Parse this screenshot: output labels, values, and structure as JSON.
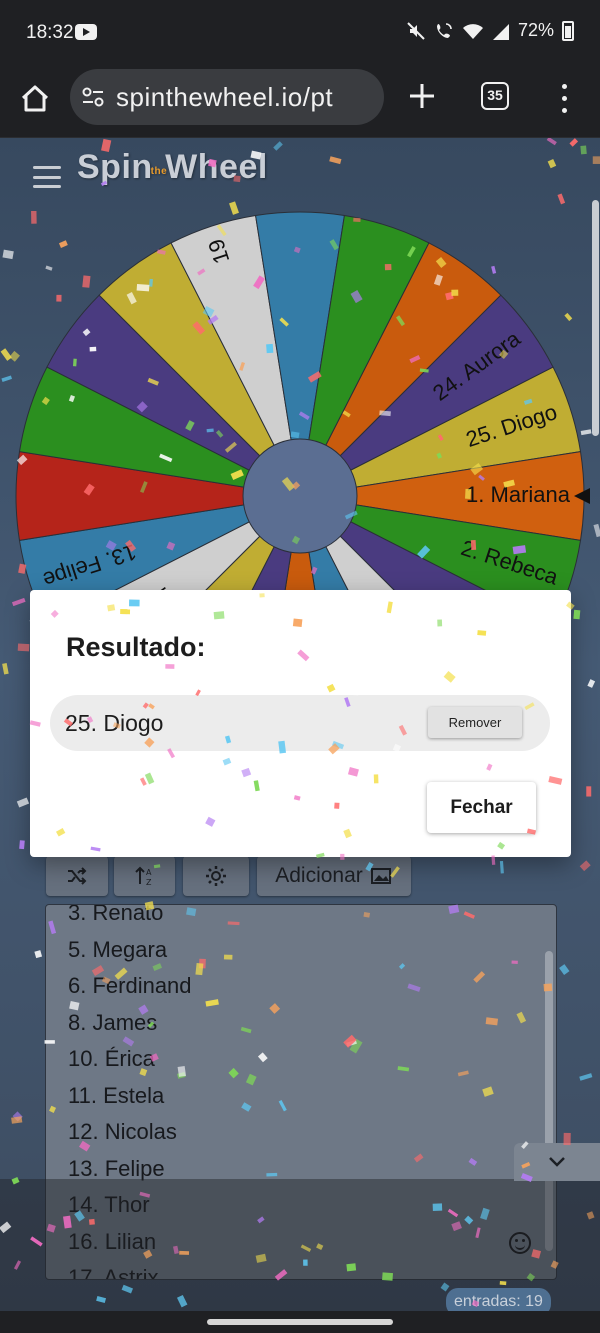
{
  "status_bar": {
    "time": "18:32",
    "battery": "72%",
    "icons": [
      "youtube-icon",
      "mute-icon",
      "wifi-calling-icon",
      "wifi-icon",
      "signal-icon",
      "battery-icon"
    ]
  },
  "browser": {
    "url": "spinthewheel.io/pt",
    "tab_count": "35",
    "icons": [
      "home-icon",
      "site-settings-icon",
      "plus-icon",
      "more-vert-icon"
    ]
  },
  "app": {
    "logo_main_a": "Spin",
    "logo_the": "the",
    "logo_main_b": "Wheel"
  },
  "wheel": {
    "segments": [
      {
        "label": "25. Diogo",
        "color": "#c0ad33"
      },
      {
        "label": "1. Mariana",
        "color": "#d0600f"
      },
      {
        "label": "2. Rebeca",
        "color": "#2b8f1f"
      },
      {
        "label": "3. Renato",
        "color": "#4a3b80"
      },
      {
        "label": "5. Megara",
        "color": "#cfcfcf"
      },
      {
        "label": "6. Ferdinand",
        "color": "#347ca7"
      },
      {
        "label": "8. James",
        "color": "#c95b0d"
      },
      {
        "label": "10. Érica",
        "color": "#4a3b80"
      },
      {
        "label": "11. Estela",
        "color": "#c0ad33"
      },
      {
        "label": "12. Nicolas",
        "color": "#cfcfcf"
      },
      {
        "label": "13. Felipe",
        "color": "#347ca7"
      },
      {
        "label": "",
        "color": "#b5241a"
      },
      {
        "label": "",
        "color": "#2b8f1f"
      },
      {
        "label": "",
        "color": "#4a3b80"
      },
      {
        "label": "",
        "color": "#c0ad33"
      },
      {
        "label": "19",
        "color": "#cfcfcf"
      },
      {
        "label": "",
        "color": "#347ca7"
      },
      {
        "label": "",
        "color": "#2b8f1f"
      },
      {
        "label": "",
        "color": "#c95b0d"
      },
      {
        "label": "24. Aurora",
        "color": "#4a3b80"
      }
    ],
    "hub_color": "#5b6e92"
  },
  "controls": {
    "add_label": "Adicionar",
    "icons": [
      "shuffle-icon",
      "sort-icon",
      "settings-icon",
      "add-image-icon"
    ]
  },
  "entries": {
    "items": [
      "3. Renato",
      "5. Megara",
      "6. Ferdinand",
      "8. James",
      "10. Érica",
      "11. Estela",
      "12. Nicolas",
      "13. Felipe",
      "14. Thor",
      "16. Lilian",
      "17. Astrix"
    ],
    "count_label": "entradas: 19"
  },
  "dialog": {
    "title": "Resultado:",
    "result": "25. Diogo",
    "remove_label": "Remover",
    "close_label": "Fechar"
  }
}
